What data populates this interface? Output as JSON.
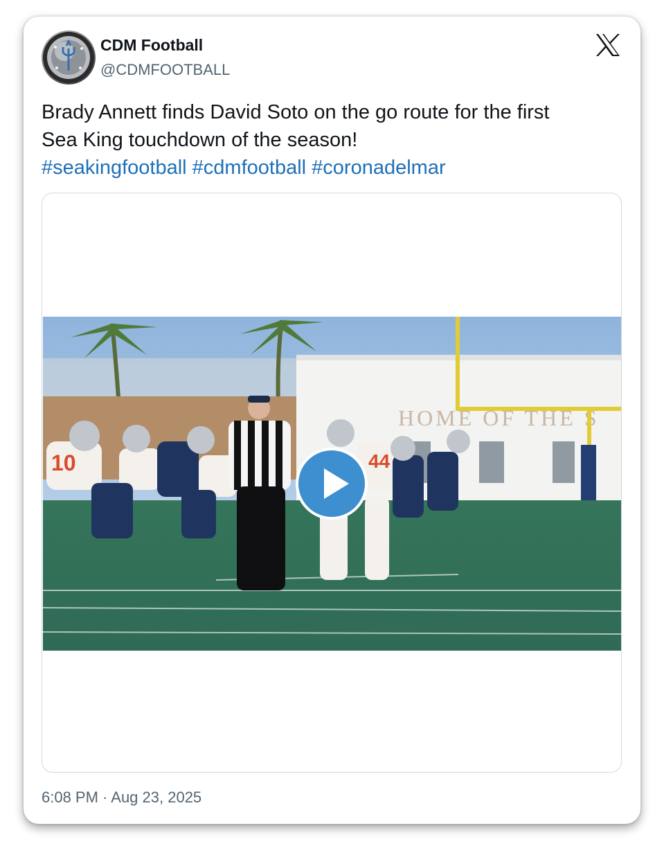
{
  "author": {
    "name": "CDM Football",
    "handle": "@CDMFOOTBALL",
    "avatar_icon": "trident-ring-icon"
  },
  "platform_icon": "x-logo-icon",
  "tweet": {
    "line1": "Brady Annett finds David Soto on the go route for the first",
    "line2": "Sea King touchdown of the season!",
    "hashtags": [
      "#seakingfootball",
      "#cdmfootball",
      "#coronadelmar"
    ],
    "hashtag_color": "#1d6fb8"
  },
  "media": {
    "type": "video",
    "play_icon": "play-icon",
    "play_color": "#3d8fd0",
    "scene_sign_text": "HOME OF THE S"
  },
  "timestamp": "6:08 PM · Aug 23, 2025"
}
